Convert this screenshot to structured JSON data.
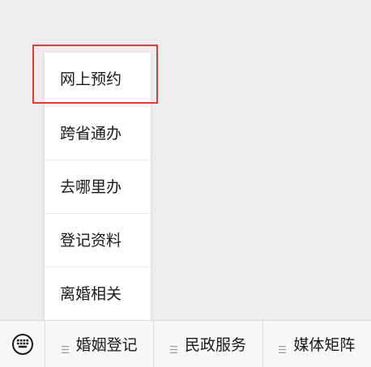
{
  "popup_menu": {
    "items": [
      {
        "label": "网上预约",
        "highlighted": true
      },
      {
        "label": "跨省通办"
      },
      {
        "label": "去哪里办"
      },
      {
        "label": "登记资料"
      },
      {
        "label": "离婚相关"
      }
    ],
    "highlight_color": "#e23a3a"
  },
  "bottom_bar": {
    "keyboard_icon": "keyboard-icon",
    "menu_icon": "hamburger-icon",
    "tabs": [
      {
        "label": "婚姻登记"
      },
      {
        "label": "民政服务"
      },
      {
        "label": "媒体矩阵"
      }
    ]
  }
}
